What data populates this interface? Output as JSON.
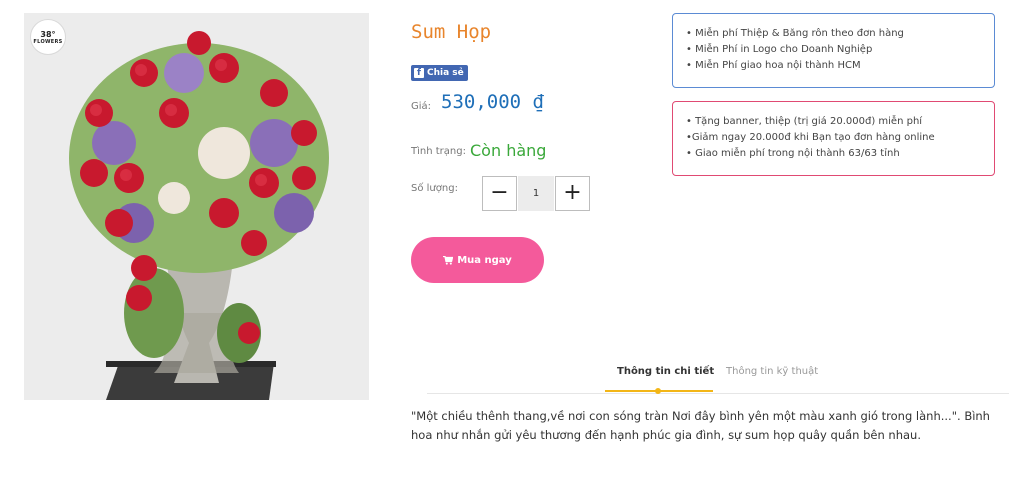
{
  "brand_logo": {
    "number": "38°",
    "name": "FLOWERS"
  },
  "product": {
    "image_alt": "flower-arrangement-image",
    "title": "Sum Họp",
    "share_label": "Chia sẻ",
    "price_label": "Giá:",
    "price": "530,000 ₫",
    "stock_label": "Tình trạng:",
    "stock_value": "Còn hàng",
    "quantity_label": "Số lượng:",
    "quantity": "1",
    "minus_symbol": "−",
    "plus_symbol": "+",
    "buy_label": "Mua ngay"
  },
  "promo_blue": [
    "• Miễn phí Thiệp & Băng rôn theo đơn hàng",
    "• Miễn Phí in Logo cho Doanh Nghiệp",
    "• Miễn Phí giao hoa nội thành HCM"
  ],
  "promo_red": [
    "• Tặng banner, thiệp (trị giá 20.000đ) miễn phí",
    "•Giảm ngay 20.000đ khi Bạn tạo đơn hàng online",
    "• Giao miễn phí trong nội thành 63/63 tỉnh"
  ],
  "tabs": [
    {
      "label": "Thông tin chi tiết",
      "active": true
    },
    {
      "label": "Thông tin kỹ thuật",
      "active": false
    }
  ],
  "description": "\"Một chiều thênh thang,về nơi con sóng tràn Nơi đây bình yên một màu xanh gió trong lành...\". Bình hoa như nhắn gửi yêu thương đến hạnh phúc gia đình, sự sum họp quây quần bên nhau.",
  "colors": {
    "title": "#e8852c",
    "price": "#1f6fb8",
    "stock": "#3aa83a",
    "buy_button": "#f45a9b",
    "share_button": "#4267b2",
    "promo_blue_border": "#5b8bd4",
    "promo_red_border": "#e04a73",
    "tab_accent": "#f3b617"
  },
  "icons": {
    "facebook": "facebook-icon",
    "cart": "cart-icon"
  }
}
